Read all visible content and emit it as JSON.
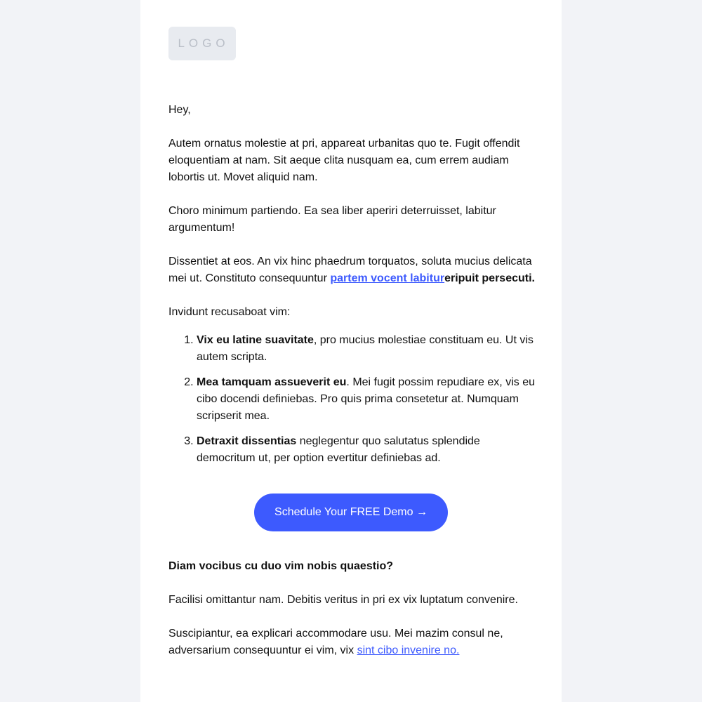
{
  "logo": {
    "text": "LOGO"
  },
  "greeting": "Hey,",
  "paragraph1": "Autem ornatus molestie at pri, appareat urbanitas quo te. Fugit offendit eloquentiam at nam. Sit aeque clita nusquam ea, cum errem audiam lobortis ut. Movet aliquid nam.",
  "paragraph2": "Choro minimum partiendo. Ea sea liber aperiri deterruisset, labitur argumentum!",
  "paragraph3": {
    "text": "Dissentiet at eos. An vix hinc phaedrum torquatos, soluta mucius delicata mei ut. Constituto consequuntur ",
    "link_text": "partem vocent labitur",
    "bold_tail": "eripuit persecuti."
  },
  "list_intro": "Invidunt recusaboat vim:",
  "list_items": [
    {
      "bold": "Vix eu latine suavitate",
      "text": ", pro mucius molestiae constituam eu. Ut vis autem scripta."
    },
    {
      "bold": "Mea tamquam assueverit eu",
      "text": ". Mei fugit possim repudiare ex, vis eu cibo docendi definiebas. Pro quis prima consetetur at. Numquam scripserit mea."
    },
    {
      "bold": "Detraxit dissentias",
      "text": " neglegentur quo salutatus splendide democritum ut, per option evertitur definiebas ad."
    }
  ],
  "cta": {
    "label": "Schedule Your FREE Demo →"
  },
  "question": "Diam vocibus cu duo vim nobis quaestio?",
  "paragraph4": "Facilisi omittantur nam. Debitis veritus in pri ex vix luptatum convenire.",
  "paragraph5": {
    "text": "Suscipiantur, ea explicari accommodare usu. Mei mazim consul ne, adversarium consequuntur ei vim, vix ",
    "link_text": "sint cibo invenire no."
  },
  "colors": {
    "accent": "#3d5afe",
    "background": "#f2f3f7",
    "card": "#ffffff",
    "logo_bg": "#e8ebf0"
  }
}
